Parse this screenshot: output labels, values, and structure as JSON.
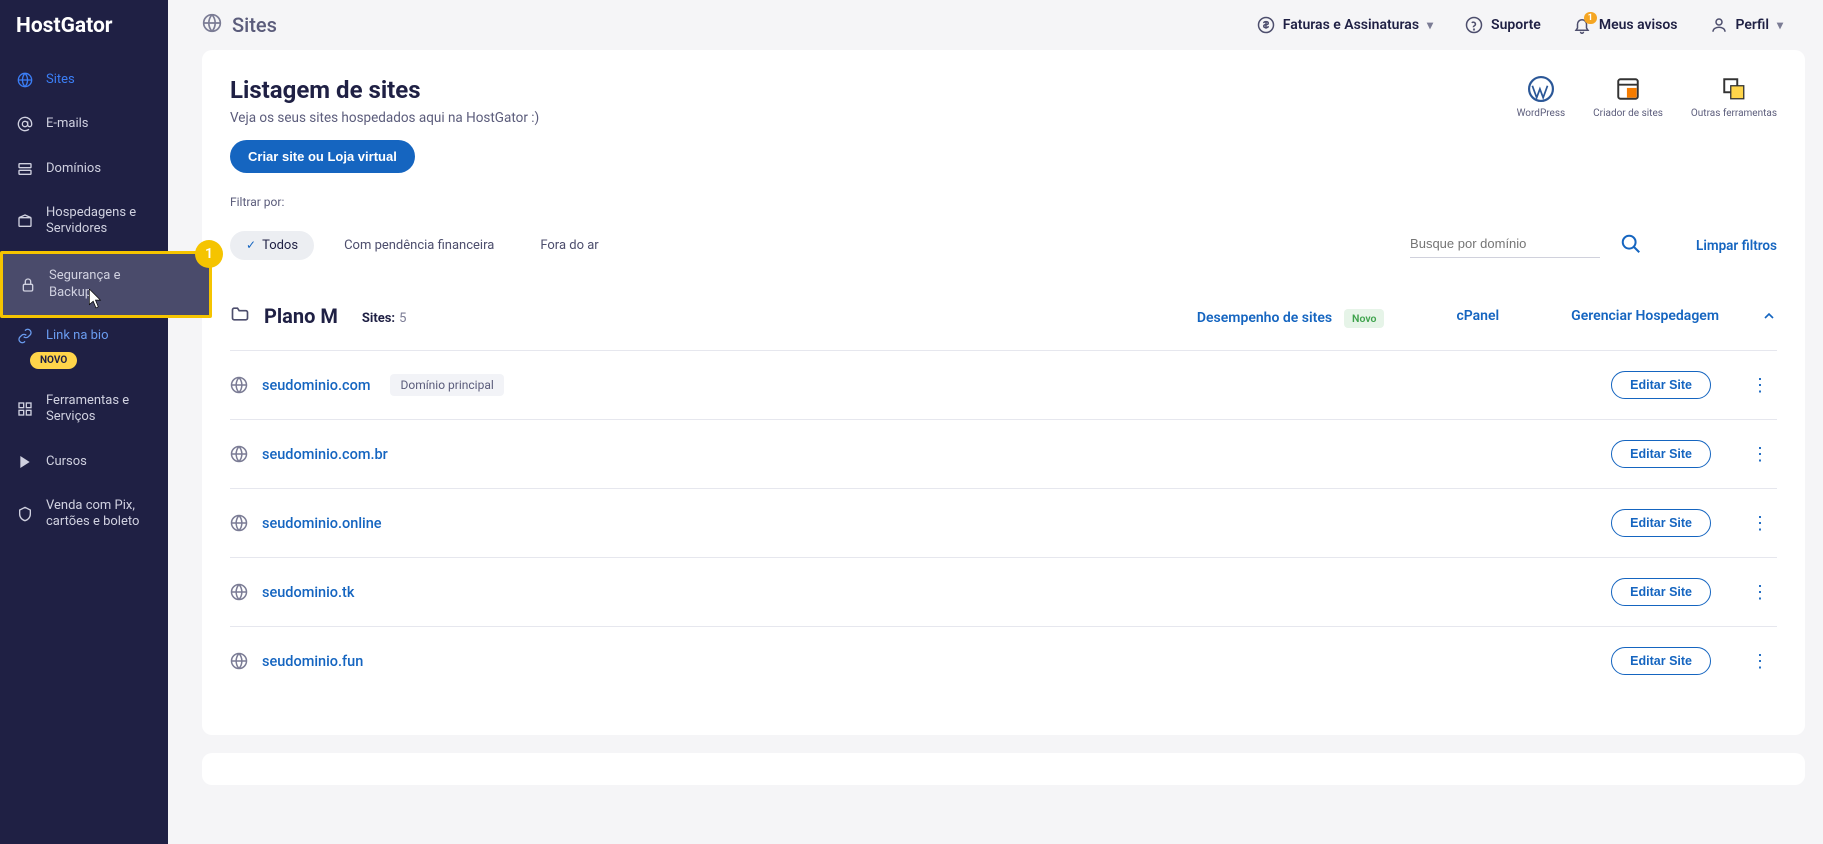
{
  "brand": "HostGator",
  "sidebar": {
    "items": [
      {
        "label": "Sites"
      },
      {
        "label": "E-mails"
      },
      {
        "label": "Domínios"
      },
      {
        "label": "Hospedagens e Servidores"
      },
      {
        "label": "Segurança e Backup"
      },
      {
        "label": "Link na bio",
        "badge": "NOVO"
      },
      {
        "label": "Ferramentas e Serviços"
      },
      {
        "label": "Cursos"
      },
      {
        "label": "Venda com Pix, cartões e boleto"
      }
    ]
  },
  "topbar": {
    "title": "Sites",
    "invoices": "Faturas e Assinaturas",
    "support": "Suporte",
    "notices": "Meus avisos",
    "notices_badge": "1",
    "profile": "Perfil"
  },
  "listing": {
    "title": "Listagem de sites",
    "subtitle": "Veja os seus sites hospedados aqui na HostGator :)",
    "create_btn": "Criar site ou Loja virtual"
  },
  "tools": {
    "wordpress": "WordPress",
    "builder": "Criador de sites",
    "other": "Outras ferramentas"
  },
  "filter": {
    "label": "Filtrar por:",
    "all": "Todos",
    "pending": "Com pendência financeira",
    "offline": "Fora do ar",
    "search_placeholder": "Busque por domínio",
    "clear": "Limpar filtros"
  },
  "plan": {
    "name": "Plano M",
    "sites_label": "Sites:",
    "sites_count": "5",
    "performance": "Desempenho de sites",
    "novo": "Novo",
    "cpanel": "cPanel",
    "manage": "Gerenciar Hospedagem"
  },
  "sites": [
    {
      "domain": "seudominio.com",
      "main_badge": "Domínio principal",
      "edit": "Editar Site"
    },
    {
      "domain": "seudominio.com.br",
      "edit": "Editar Site"
    },
    {
      "domain": "seudominio.online",
      "edit": "Editar Site"
    },
    {
      "domain": "seudominio.tk",
      "edit": "Editar Site"
    },
    {
      "domain": "seudominio.fun",
      "edit": "Editar Site"
    }
  ],
  "annotation": {
    "number": "1"
  }
}
